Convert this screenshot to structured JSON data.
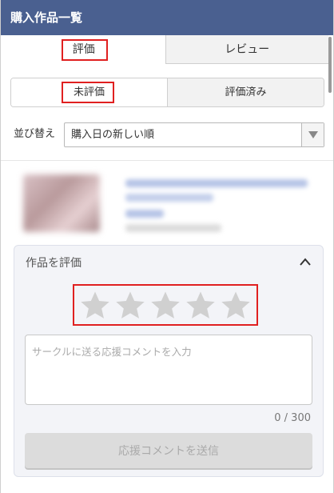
{
  "header": {
    "title": "購入作品一覧"
  },
  "tabs": [
    {
      "label": "評価",
      "active": true
    },
    {
      "label": "レビュー",
      "active": false
    }
  ],
  "filter": [
    {
      "label": "未評価",
      "active": true
    },
    {
      "label": "評価済み",
      "active": false
    }
  ],
  "sort": {
    "label": "並び替え",
    "selected": "購入日の新しい順"
  },
  "rating_panel": {
    "title": "作品を評価",
    "stars_total": 5,
    "stars_selected": 0,
    "comment_placeholder": "サークルに送る応援コメントを入力",
    "comment_value": "",
    "counter": "0 / 300",
    "submit_label": "応援コメントを送信"
  },
  "colors": {
    "header_bg": "#4a6090",
    "highlight": "#e02020",
    "star_empty": "#d0d0d0",
    "panel_bg": "#f3f4f8"
  },
  "icons": [
    "dropdown-arrow-icon",
    "chevron-up-icon",
    "star-icon"
  ]
}
